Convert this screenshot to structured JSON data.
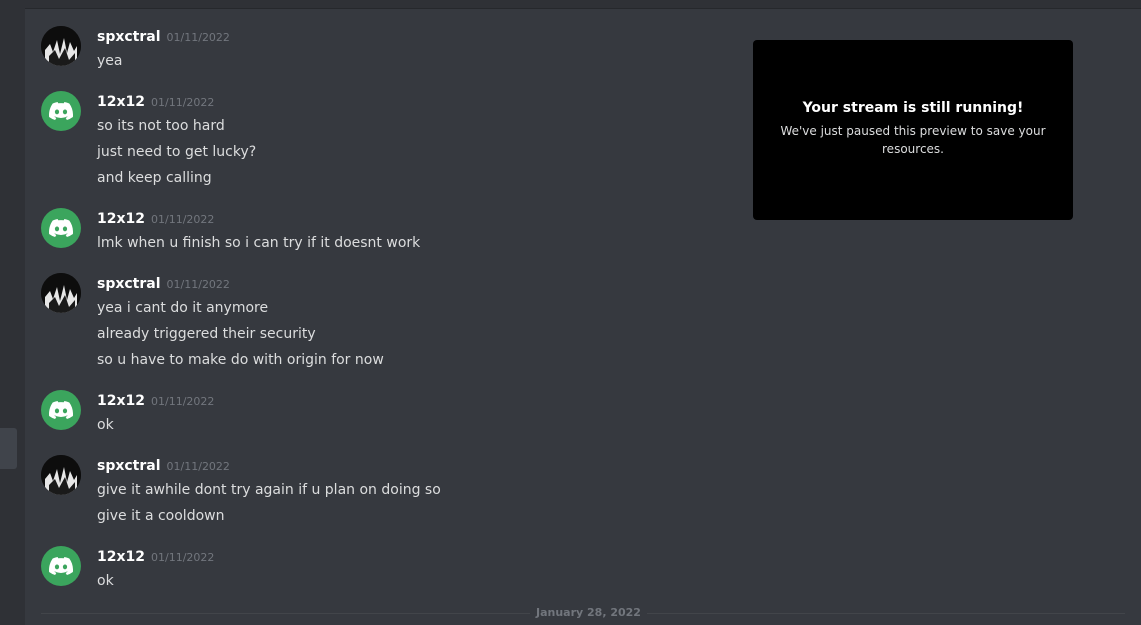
{
  "messages": [
    {
      "author": "spxctral",
      "avatar": "spxctral-avatar",
      "timestamp": "01/11/2022",
      "lines": [
        "yea"
      ]
    },
    {
      "author": "12x12",
      "avatar": "discord-avatar",
      "timestamp": "01/11/2022",
      "lines": [
        "so its not too hard",
        "just need to get lucky?",
        "and keep calling"
      ]
    },
    {
      "author": "12x12",
      "avatar": "discord-avatar",
      "timestamp": "01/11/2022",
      "lines": [
        "lmk when u finish so i can try if it doesnt work"
      ]
    },
    {
      "author": "spxctral",
      "avatar": "spxctral-avatar",
      "timestamp": "01/11/2022",
      "lines": [
        "yea i cant do it anymore",
        "already triggered their security",
        "so u have to make do with origin for now"
      ]
    },
    {
      "author": "12x12",
      "avatar": "discord-avatar",
      "timestamp": "01/11/2022",
      "lines": [
        "ok"
      ]
    },
    {
      "author": "spxctral",
      "avatar": "spxctral-avatar",
      "timestamp": "01/11/2022",
      "lines": [
        "give it awhile dont try again if u plan on doing so",
        "give it a cooldown"
      ]
    },
    {
      "author": "12x12",
      "avatar": "discord-avatar",
      "timestamp": "01/11/2022",
      "lines": [
        "ok"
      ]
    }
  ],
  "date_divider": "January 28, 2022",
  "stream_preview": {
    "title": "Your stream is still running!",
    "subtitle": "We've just paused this preview to save your resources."
  },
  "colors": {
    "background": "#36393f",
    "discord_green": "#3ba55d",
    "username": "#ffffff",
    "message_text": "#dcddde",
    "timestamp": "#72767d"
  }
}
